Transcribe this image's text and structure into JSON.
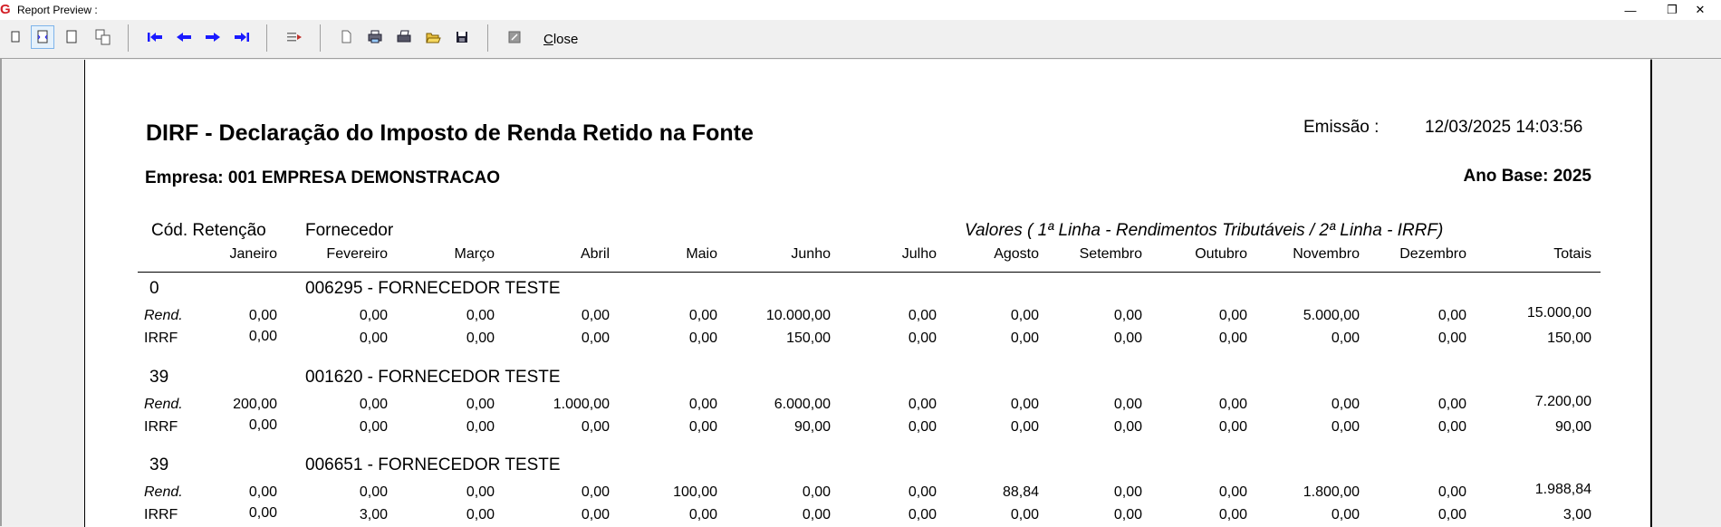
{
  "window": {
    "title": "Report Preview :",
    "app_icon_glyph": "G",
    "minimize_glyph": "—",
    "maximize_glyph": "❐",
    "close_glyph": "✕"
  },
  "toolbar": {
    "close_label_first": "C",
    "close_label_rest": "lose",
    "buttons": [
      "single-page-icon",
      "page-width-icon",
      "full-page-icon",
      "multi-page-icon",
      "first-page-icon",
      "previous-page-icon",
      "next-page-icon",
      "last-page-icon",
      "goto-page-icon",
      "new-page-icon",
      "print-setup-icon",
      "print-icon",
      "open-icon",
      "save-icon",
      "export-icon"
    ],
    "accent_color": "#1a1aff"
  },
  "report": {
    "title": "DIRF - Declaração do Imposto de Renda Retido na Fonte",
    "emissao_label": "Emissão :",
    "emissao_value": "12/03/2025 14:03:56",
    "empresa": "Empresa: 001 EMPRESA DEMONSTRACAO",
    "ano_base": "Ano Base: 2025",
    "header": {
      "cod_retencao": "Cód. Retenção",
      "fornecedor": "Fornecedor",
      "valores": "Valores ( 1ª Linha - Rendimentos Tributáveis / 2ª Linha - IRRF)"
    },
    "months": [
      "Janeiro",
      "Fevereiro",
      "Março",
      "Abril",
      "Maio",
      "Junho",
      "Julho",
      "Agosto",
      "Setembro",
      "Outubro",
      "Novembro",
      "Dezembro",
      "Totais"
    ],
    "groups": [
      {
        "cod": "0",
        "supplier": "006295 - FORNECEDOR TESTE",
        "rend_label": "Rend.",
        "irrf_label": "IRRF",
        "rend": [
          "0,00",
          "0,00",
          "0,00",
          "0,00",
          "0,00",
          "10.000,00",
          "0,00",
          "0,00",
          "0,00",
          "0,00",
          "5.000,00",
          "0,00",
          "15.000,00"
        ],
        "irrf": [
          "0,00",
          "0,00",
          "0,00",
          "0,00",
          "0,00",
          "150,00",
          "0,00",
          "0,00",
          "0,00",
          "0,00",
          "0,00",
          "0,00",
          "150,00"
        ]
      },
      {
        "cod": "39",
        "supplier": "001620 - FORNECEDOR TESTE",
        "rend_label": "Rend.",
        "irrf_label": "IRRF",
        "rend": [
          "200,00",
          "0,00",
          "0,00",
          "1.000,00",
          "0,00",
          "6.000,00",
          "0,00",
          "0,00",
          "0,00",
          "0,00",
          "0,00",
          "0,00",
          "7.200,00"
        ],
        "irrf": [
          "0,00",
          "0,00",
          "0,00",
          "0,00",
          "0,00",
          "90,00",
          "0,00",
          "0,00",
          "0,00",
          "0,00",
          "0,00",
          "0,00",
          "90,00"
        ]
      },
      {
        "cod": "39",
        "supplier": "006651 - FORNECEDOR TESTE",
        "rend_label": "Rend.",
        "irrf_label": "IRRF",
        "rend": [
          "0,00",
          "0,00",
          "0,00",
          "0,00",
          "100,00",
          "0,00",
          "0,00",
          "88,84",
          "0,00",
          "0,00",
          "1.800,00",
          "0,00",
          "1.988,84"
        ],
        "irrf": [
          "0,00",
          "3,00",
          "0,00",
          "0,00",
          "0,00",
          "0,00",
          "0,00",
          "0,00",
          "0,00",
          "0,00",
          "0,00",
          "0,00",
          "3,00"
        ]
      }
    ]
  }
}
